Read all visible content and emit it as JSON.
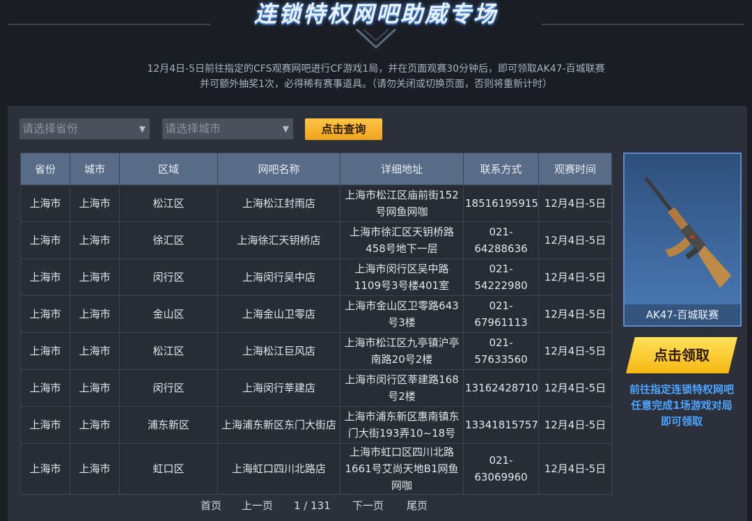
{
  "header": {
    "title": "连锁特权网吧助威专场",
    "desc_line1": "12月4日-5日前往指定的CFS观赛网吧进行CF游戏1局，并在页面观赛30分钟后，即可领取AK47-百城联赛",
    "desc_line2": "并可额外抽奖1次，必得稀有赛事道具。（请勿关闭或切换页面，否则将重新计时）"
  },
  "filters": {
    "province_placeholder": "请选择省份",
    "city_placeholder": "请选择城市",
    "query_label": "点击查询"
  },
  "table": {
    "headers": [
      "省份",
      "城市",
      "区域",
      "网吧名称",
      "详细地址",
      "联系方式",
      "观赛时间"
    ],
    "rows": [
      [
        "上海市",
        "上海市",
        "松江区",
        "上海松江封雨店",
        "上海市松江区庙前街152号网鱼网咖",
        "18516195915",
        "12月4日-5日"
      ],
      [
        "上海市",
        "上海市",
        "徐汇区",
        "上海徐汇天钥桥店",
        "上海市徐汇区天钥桥路458号地下一层",
        "021-64288636",
        "12月4日-5日"
      ],
      [
        "上海市",
        "上海市",
        "闵行区",
        "上海闵行吴中店",
        "上海市闵行区吴中路1109号3号楼401室",
        "021-54222980",
        "12月4日-5日"
      ],
      [
        "上海市",
        "上海市",
        "金山区",
        "上海金山卫零店",
        "上海市金山区卫零路643号3楼",
        "021-67961113",
        "12月4日-5日"
      ],
      [
        "上海市",
        "上海市",
        "松江区",
        "上海松江巨风店",
        "上海市松江区九亭镇沪亭南路20号2楼",
        "021-57633560",
        "12月4日-5日"
      ],
      [
        "上海市",
        "上海市",
        "闵行区",
        "上海闵行莘建店",
        "上海市闵行区莘建路168号2楼",
        "13162428710",
        "12月4日-5日"
      ],
      [
        "上海市",
        "上海市",
        "浦东新区",
        "上海浦东新区东门大街店",
        "上海市浦东新区惠南镇东门大街193弄10~18号",
        "13341815757",
        "12月4日-5日"
      ],
      [
        "上海市",
        "上海市",
        "虹口区",
        "上海虹口四川北路店",
        "上海市虹口区四川北路1661号艾尚天地B1网鱼网咖",
        "021-63069960",
        "12月4日-5日"
      ]
    ]
  },
  "pager": {
    "first": "首页",
    "prev": "上一页",
    "page_info": "1 / 131",
    "next": "下一页",
    "last": "尾页"
  },
  "prize": {
    "name": "AK47-百城联赛",
    "claim_label": "点击领取",
    "note_line1": "前往指定连锁特权网吧",
    "note_line2": "任意完成1场游戏对局",
    "note_line3": "即可领取"
  },
  "icons": {
    "dropdown": "chevron-down-icon",
    "weapon": "ak47-rifle-icon"
  },
  "colors": {
    "accent_yellow": "#ffc64a",
    "accent_blue": "#4ea5ff",
    "header_row": "#596c87"
  }
}
